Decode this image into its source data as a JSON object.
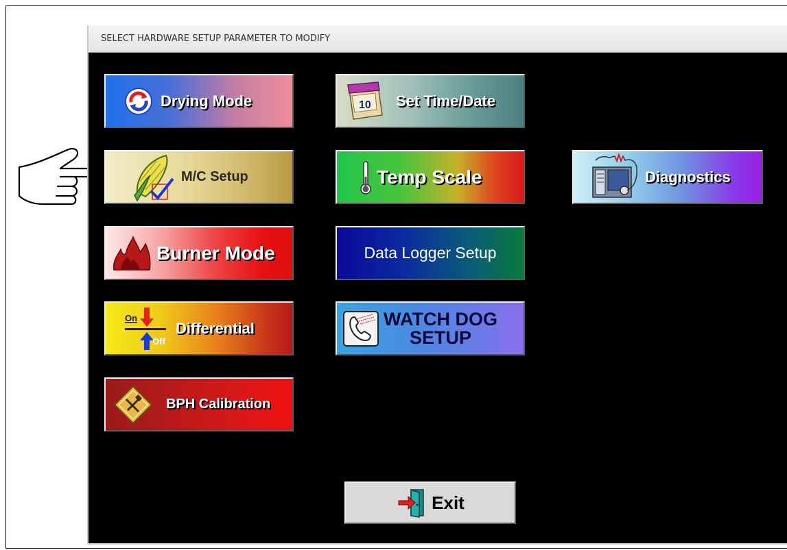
{
  "window": {
    "title": "SELECT HARDWARE SETUP PARAMETER TO MODIFY"
  },
  "buttons": {
    "drying_mode": "Drying Mode",
    "set_time_date": "Set Time/Date",
    "mc_setup": "M/C Setup",
    "temp_scale": "Temp Scale",
    "diagnostics": "Diagnostics",
    "burner_mode": "Burner Mode",
    "data_logger_setup": "Data Logger Setup",
    "differential": "Differential",
    "watch_dog_line1": "WATCH DOG",
    "watch_dog_line2": "SETUP",
    "bph_calibration": "BPH Calibration",
    "exit": "Exit"
  },
  "icons": {
    "drying_mode": "refresh-icon",
    "set_time_date": "calendar-icon",
    "mc_setup": "corn-icon",
    "temp_scale": "thermometer-icon",
    "diagnostics": "monitor-icon",
    "burner_mode": "flame-icon",
    "differential": "on-off-icon",
    "watch_dog": "phone-icon",
    "bph_calibration": "tools-icon",
    "exit": "exit-door-icon"
  },
  "differential_icon_text": {
    "on": "On",
    "off": "Off"
  },
  "calendar_icon_text": "10",
  "pointer": "pointing-hand-icon"
}
